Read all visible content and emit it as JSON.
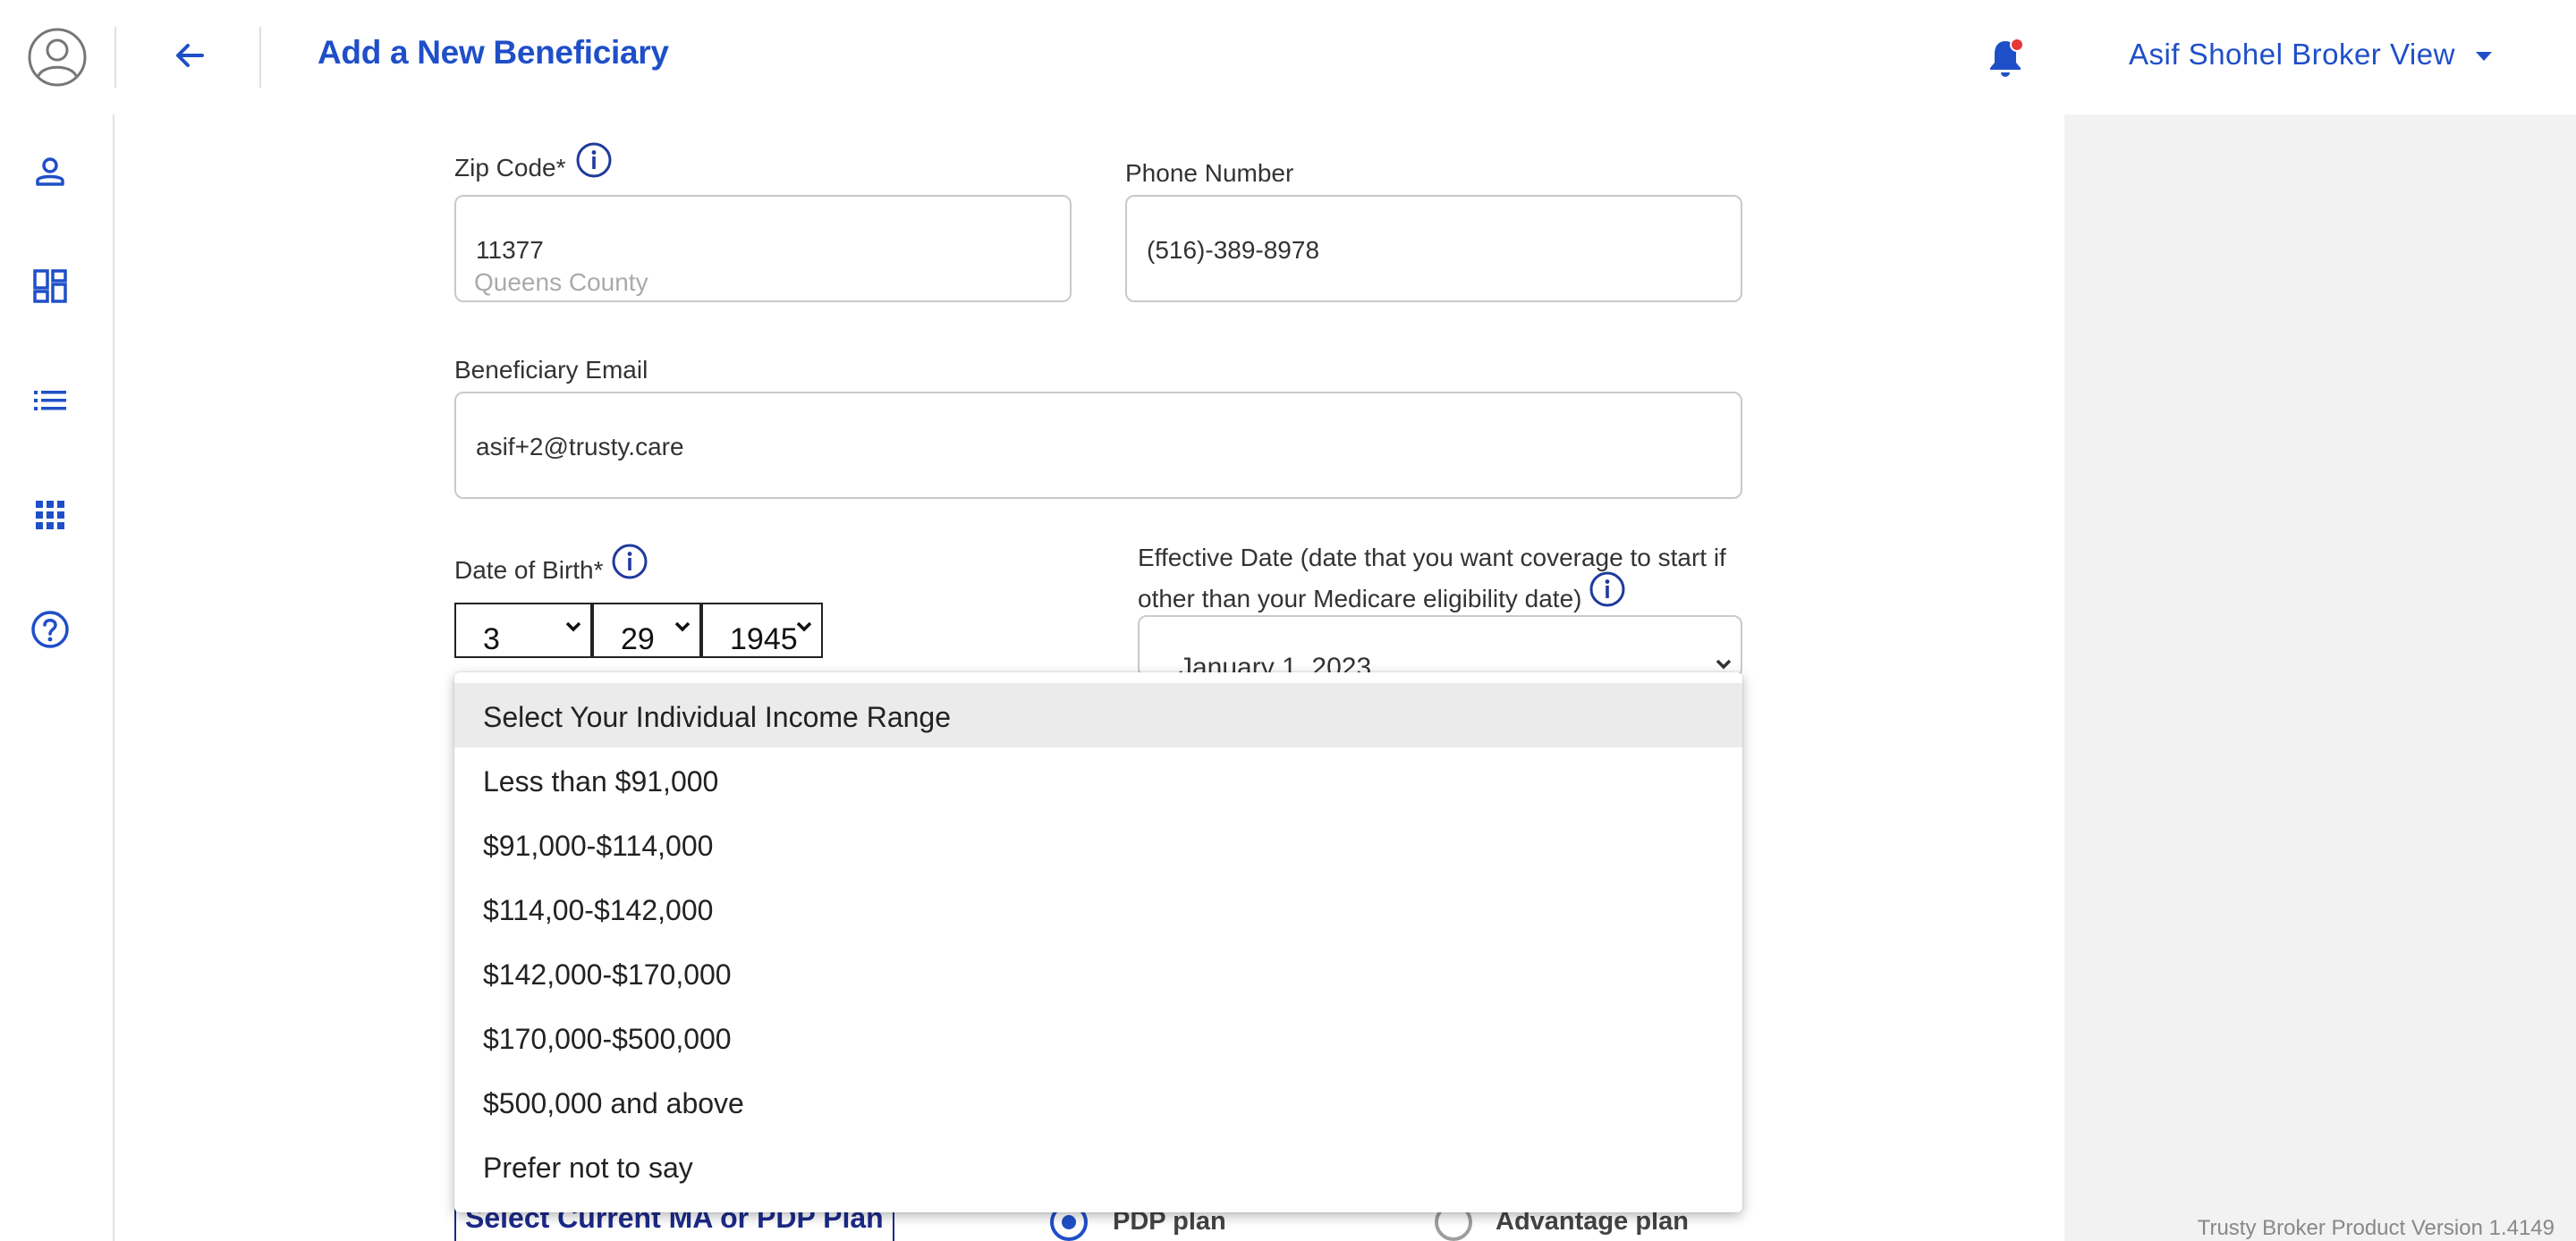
{
  "header": {
    "title": "Add a New Beneficiary",
    "user": "Asif Shohel Broker View"
  },
  "sidebar": {
    "items": [
      {
        "icon": "person-icon"
      },
      {
        "icon": "dashboard-icon"
      },
      {
        "icon": "list-icon"
      },
      {
        "icon": "apps-grid-icon"
      },
      {
        "icon": "help-icon"
      }
    ]
  },
  "form": {
    "zip": {
      "label": "Zip Code*",
      "value": "11377",
      "county": "Queens County"
    },
    "phone": {
      "label": "Phone Number",
      "value": "(516)-389-8978"
    },
    "email": {
      "label": "Beneficiary Email",
      "value": "asif+2@trusty.care"
    },
    "dob": {
      "label": "Date of Birth*",
      "month": "3",
      "day": "29",
      "year": "1945"
    },
    "effective": {
      "label_line1": "Effective Date (date that you want coverage to start if",
      "label_line2": "other than your Medicare eligibility date)",
      "value": "January 1, 2023"
    }
  },
  "income_dropdown": {
    "selected_index": 0,
    "options": [
      "Select Your Individual Income Range",
      "Less than $91,000",
      "$91,000-$114,000",
      "$114,00-$142,000",
      "$142,000-$170,000",
      "$170,000-$500,000",
      "$500,000 and above",
      "Prefer not to say"
    ]
  },
  "plan": {
    "button": "Select Current MA or PDP Plan",
    "option_pdp": "PDP plan",
    "option_advantage": "Advantage plan",
    "selected": "PDP plan"
  },
  "footer": {
    "version": "Trusty Broker Product Version 1.4149"
  },
  "colors": {
    "accent": "#1f4fc8",
    "navy": "#1c2a8a",
    "selected_bg": "#ebebeb",
    "panel": "#f2f2f2",
    "notification_dot": "#e53935"
  }
}
